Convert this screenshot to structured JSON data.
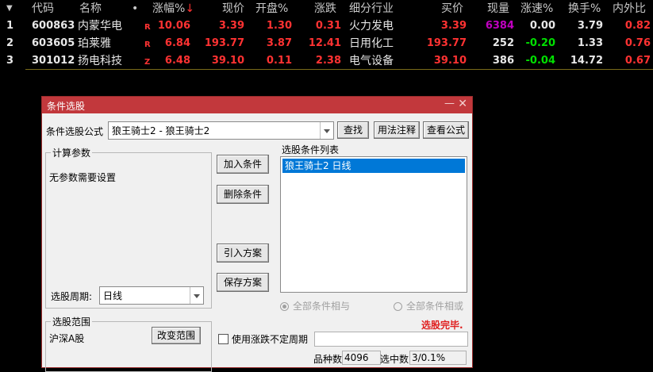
{
  "table": {
    "sort_indicator": "▼",
    "sort_arrow": "↓",
    "headers": {
      "code": "代码",
      "name": "名称",
      "dot": "•",
      "chg_pct": "涨幅%",
      "price": "现价",
      "open_pct": "开盘%",
      "change": "涨跌",
      "industry": "细分行业",
      "bid": "买价",
      "volume": "现量",
      "speed": "涨速%",
      "turnover": "换手%",
      "ratio": "内外比"
    },
    "rows": [
      {
        "idx": "1",
        "code": "600863",
        "name": "内蒙华电",
        "flag": "R",
        "chg_pct": "10.06",
        "price": "3.39",
        "open_pct": "1.30",
        "change": "0.31",
        "industry": "火力发电",
        "bid": "3.39",
        "volume": "6384",
        "speed": "0.00",
        "turnover": "3.79",
        "ratio": "0.82"
      },
      {
        "idx": "2",
        "code": "603605",
        "name": "珀莱雅",
        "flag": "R",
        "chg_pct": "6.84",
        "price": "193.77",
        "open_pct": "3.87",
        "change": "12.41",
        "industry": "日用化工",
        "bid": "193.77",
        "volume": "252",
        "speed": "-0.20",
        "turnover": "1.33",
        "ratio": "0.76"
      },
      {
        "idx": "3",
        "code": "301012",
        "name": "扬电科技",
        "flag": "Z",
        "chg_pct": "6.48",
        "price": "39.10",
        "open_pct": "0.11",
        "change": "2.38",
        "industry": "电气设备",
        "bid": "39.10",
        "volume": "386",
        "speed": "-0.04",
        "turnover": "14.72",
        "ratio": "0.67"
      }
    ]
  },
  "dialog": {
    "title": "条件选股",
    "minimize": "—",
    "close": "✕",
    "formula_label": "条件选股公式",
    "formula_value": "狼王骑士2    - 狼王骑士2",
    "find_button": "查找",
    "usage_button": "用法注释",
    "view_formula_button": "查看公式",
    "params_group": "计算参数",
    "no_params": "无参数需要设置",
    "add_condition": "加入条件",
    "delete_condition": "删除条件",
    "import_plan": "引入方案",
    "save_plan": "保存方案",
    "condition_list_label": "选股条件列表",
    "condition_items": [
      "狼王骑士2  日线"
    ],
    "period_label": "选股周期:",
    "period_value": "日线",
    "radio_and": "全部条件相与",
    "radio_or": "全部条件相或",
    "status": "选股完毕.",
    "scope_group": "选股范围",
    "scope_value": "沪深A股",
    "change_scope": "改变范围",
    "irregular_period": "使用涨跌不定周期",
    "count_label": "品种数",
    "count_value": "4096",
    "selected_label": "选中数",
    "selected_value": "3/0.1%"
  },
  "colors": {
    "up": "#ff3232",
    "down": "#00e000",
    "title_bar": "#c2383c",
    "selection": "#0078d7"
  }
}
